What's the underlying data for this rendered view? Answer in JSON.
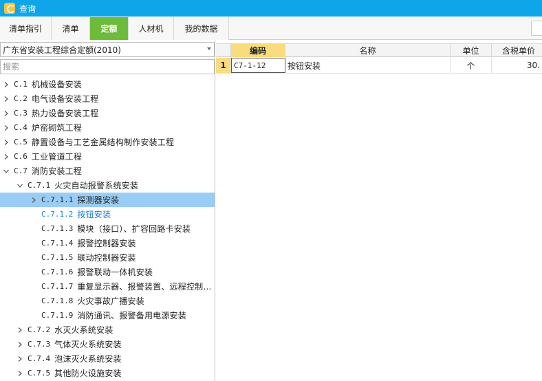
{
  "window": {
    "title": "查询"
  },
  "tabs": [
    {
      "label": "清单指引"
    },
    {
      "label": "清单"
    },
    {
      "label": "定额"
    },
    {
      "label": "人材机"
    },
    {
      "label": "我的数据"
    }
  ],
  "active_tab": "定额",
  "left": {
    "quota_library": "广东省安装工程综合定额(2010)",
    "search_placeholder": "搜索",
    "tree": [
      {
        "code": "C.1",
        "text": "机械设备安装"
      },
      {
        "code": "C.2",
        "text": "电气设备安装工程"
      },
      {
        "code": "C.3",
        "text": "热力设备安装工程"
      },
      {
        "code": "C.4",
        "text": "炉窑砌筑工程"
      },
      {
        "code": "C.5",
        "text": "静置设备与工艺金属结构制作安装工程"
      },
      {
        "code": "C.6",
        "text": "工业管道工程"
      },
      {
        "code": "C.7",
        "text": "消防安装工程"
      },
      {
        "code": "C.7.1",
        "text": "火灾自动报警系统安装"
      },
      {
        "code": "C.7.1.1",
        "text": "探测器安装"
      },
      {
        "code": "C.7.1.2",
        "text": "按钮安装"
      },
      {
        "code": "C.7.1.3",
        "text": "模块（接口）、扩容回路卡安装"
      },
      {
        "code": "C.7.1.4",
        "text": "报警控制器安装"
      },
      {
        "code": "C.7.1.5",
        "text": "联动控制器安装"
      },
      {
        "code": "C.7.1.6",
        "text": "报警联动一体机安装"
      },
      {
        "code": "C.7.1.7",
        "text": "重复显示器、报警装置、远程控制…"
      },
      {
        "code": "C.7.1.8",
        "text": "火灾事故广播安装"
      },
      {
        "code": "C.7.1.9",
        "text": "消防通讯、报警备用电源安装"
      },
      {
        "code": "C.7.2",
        "text": "水灭火系统安装"
      },
      {
        "code": "C.7.3",
        "text": "气体灭火系统安装"
      },
      {
        "code": "C.7.4",
        "text": "泡沫灭火系统安装"
      },
      {
        "code": "C.7.5",
        "text": "其他防火设施安装"
      }
    ]
  },
  "grid": {
    "columns": [
      "编码",
      "名称",
      "单位",
      "含税单价"
    ],
    "rows": [
      {
        "num": "1",
        "code": "C7-1-12",
        "name": "按钮安装",
        "unit": "个",
        "price": "30."
      }
    ]
  }
}
